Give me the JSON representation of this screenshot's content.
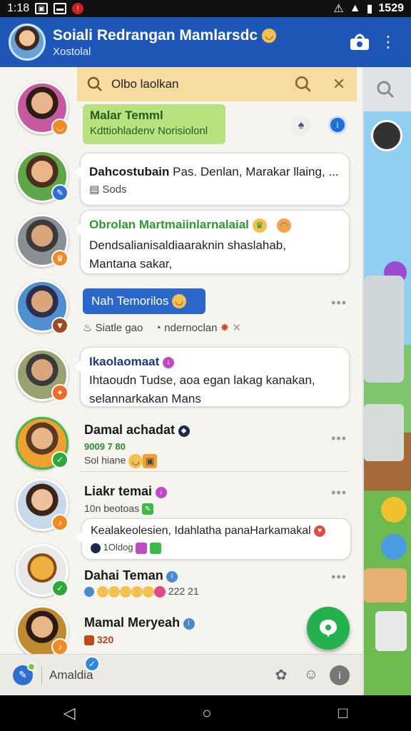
{
  "status": {
    "time": "1:18",
    "right_text": "1529"
  },
  "header": {
    "title": "Soiali Redrangan Mamlarsdc",
    "subtitle": "Xostolal"
  },
  "search": {
    "value": "Olbo laolkan"
  },
  "rows": [
    {
      "label1": "Malar Temml",
      "label2": "Kdttiohladenv Norisiolonl"
    },
    {
      "name": "Dahcostubain",
      "text": "Pas. Denlan, Marakar llaing, ...",
      "sub": "Sods"
    },
    {
      "title": "Obrolan Martmaiinlarnalaial",
      "text1": "Dendsalianisaldiaaraknin shaslahab,",
      "text2": "Mantana sakar,"
    },
    {
      "pill": "Nah Temorilos",
      "line_a": "Siatle gao",
      "line_b": "ndernoclan"
    },
    {
      "title": "Ikaolaomaat",
      "text1": "Ihtaoudn Tudse, aoa egan lakag kanakan,",
      "text2": "selannarkakan Mans"
    },
    {
      "name": "Damal achadat",
      "sub1": "9009 7 80",
      "sub2": "Sol hiane"
    },
    {
      "name": "Liakr temai",
      "sub": "10n beotoas"
    },
    {
      "text": "Kealakeolesien, Idahlatha panaHarkamakal",
      "sub": "1Oldog"
    },
    {
      "name": "Dahai Teman",
      "sub": "222 21"
    },
    {
      "name": "Mamal Meryeah",
      "sub": "320"
    }
  ],
  "bottom": {
    "input": "Amaldia"
  },
  "colors": {
    "header": "#1f57b8",
    "accent_green": "#22b14c",
    "search": "#f7dca1"
  }
}
